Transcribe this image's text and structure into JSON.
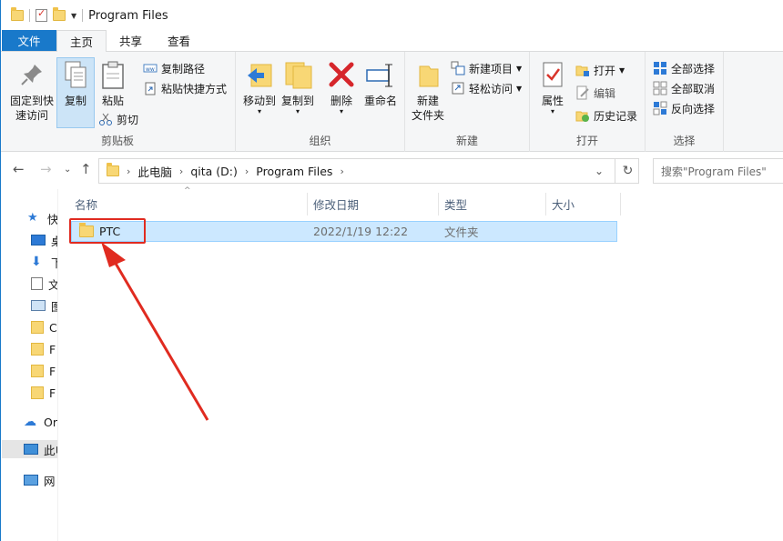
{
  "window": {
    "title": "Program Files"
  },
  "tabs": [
    {
      "label": "文件"
    },
    {
      "label": "主页"
    },
    {
      "label": "共享"
    },
    {
      "label": "查看"
    }
  ],
  "ribbon": {
    "clipboard": {
      "group_label": "剪贴板",
      "pin_label_1": "固定到快",
      "pin_label_2": "速访问",
      "copy_label": "复制",
      "paste_label": "粘贴",
      "copy_path": "复制路径",
      "paste_shortcut": "粘贴快捷方式",
      "cut": "剪切"
    },
    "organize": {
      "group_label": "组织",
      "move_to": "移动到",
      "copy_to": "复制到",
      "delete": "删除",
      "rename": "重命名"
    },
    "new": {
      "group_label": "新建",
      "new_folder_1": "新建",
      "new_folder_2": "文件夹",
      "new_item": "新建项目",
      "easy_access": "轻松访问"
    },
    "open": {
      "group_label": "打开",
      "properties": "属性",
      "open": "打开",
      "edit": "编辑",
      "history": "历史记录"
    },
    "select": {
      "group_label": "选择",
      "select_all": "全部选择",
      "select_none": "全部取消",
      "invert": "反向选择"
    }
  },
  "address": {
    "segments": [
      "此电脑",
      "qita (D:)",
      "Program Files"
    ],
    "search_placeholder": "搜索\"Program Files\""
  },
  "nav_pane": {
    "items": [
      "快",
      "桌",
      "下",
      "文",
      "图",
      "C",
      "F",
      "F",
      "F",
      "Or",
      "此电",
      "网"
    ]
  },
  "file_list": {
    "columns": [
      "名称",
      "修改日期",
      "类型",
      "大小"
    ],
    "rows": [
      {
        "name": "PTC",
        "date": "2022/1/19 12:22",
        "type": "文件夹",
        "size": ""
      }
    ]
  },
  "colors": {
    "file_tab": "#1979ca",
    "selection": "#cce8ff",
    "annotation": "#e02b20",
    "folder": "#f8d775"
  }
}
